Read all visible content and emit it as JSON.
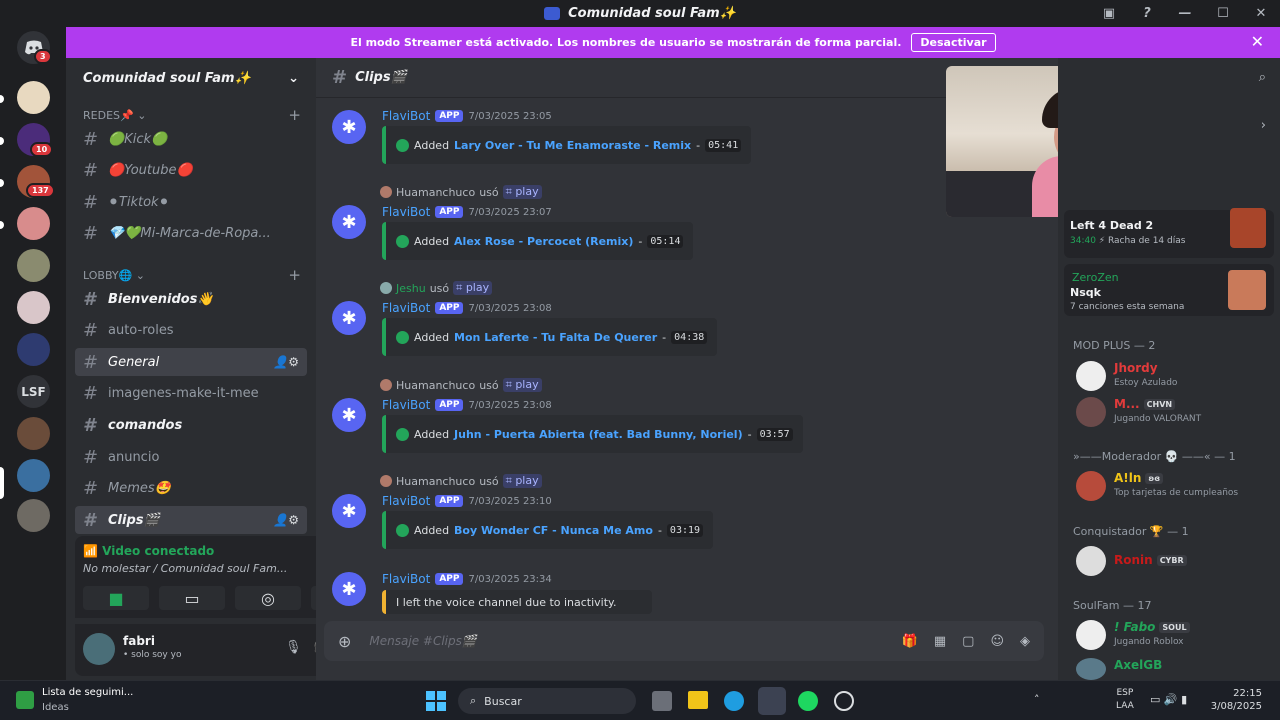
{
  "window": {
    "title": "Comunidad soul Fam✨"
  },
  "banner": {
    "text": "El modo Streamer está activado. Los nombres de usuario se mostrarán de forma parcial.",
    "button": "Desactivar"
  },
  "guilds": {
    "home_badge": "3",
    "badge1": "10",
    "badge2": "137",
    "lsf": "LSF"
  },
  "server": {
    "name": "Comunidad soul Fam✨",
    "cat_redes": "REDES📌",
    "cat_lobby": "LOBBY🌐",
    "channels": [
      {
        "label": "🟢Kick🟢"
      },
      {
        "label": "🔴Youtube🔴"
      },
      {
        "label": "⚫Tiktok⚫"
      },
      {
        "label": "💎💚Mi-Marca-de-Ropa..."
      },
      {
        "label": "Bienvenidos👋"
      },
      {
        "label": "auto-roles"
      },
      {
        "label": "General"
      },
      {
        "label": "imagenes-make-it-mee"
      },
      {
        "label": "comandos"
      },
      {
        "label": "anuncio"
      },
      {
        "label": "Memes🤩"
      },
      {
        "label": "Clips🎬"
      }
    ]
  },
  "voice": {
    "status": "Video conectado",
    "detail": "No molestar / Comunidad soul Fam..."
  },
  "user": {
    "name": "fabri",
    "status": "• solo soy yo"
  },
  "channel_header": {
    "title": "Clips🎬"
  },
  "messages": [
    {
      "reply_user": "Huamanchuco",
      "reply_cmd": "play",
      "author": "FlaviBot",
      "app": "APP",
      "time": "7/03/2025 23:05",
      "added": "Added",
      "song": "Lary Over - Tu Me Enamoraste - Remix",
      "duration": "05:41",
      "used": "usó"
    },
    {
      "reply_user": "Huamanchuco",
      "reply_cmd": "play",
      "author": "FlaviBot",
      "app": "APP",
      "time": "7/03/2025 23:07",
      "added": "Added",
      "song": "Alex Rose - Percocet (Remix)",
      "duration": "05:14",
      "used": "usó"
    },
    {
      "reply_user": "Jeshu",
      "reply_cmd": "play",
      "author": "FlaviBot",
      "app": "APP",
      "time": "7/03/2025 23:08",
      "added": "Added",
      "song": "Mon Laferte - Tu Falta De Querer",
      "duration": "04:38",
      "used": "usó"
    },
    {
      "reply_user": "Huamanchuco",
      "reply_cmd": "play",
      "author": "FlaviBot",
      "app": "APP",
      "time": "7/03/2025 23:08",
      "added": "Added",
      "song": "Juhn - Puerta Abierta (feat. Bad Bunny, Noriel)",
      "duration": "03:57",
      "used": "usó"
    },
    {
      "reply_user": "Huamanchuco",
      "reply_cmd": "play",
      "author": "FlaviBot",
      "app": "APP",
      "time": "7/03/2025 23:10",
      "added": "Added",
      "song": "Boy Wonder CF - Nunca Me Amo",
      "duration": "03:19",
      "used": "usó"
    }
  ],
  "last_msg": {
    "author": "FlaviBot",
    "app": "APP",
    "time": "7/03/2025 23:34",
    "text": "I left the voice channel due to inactivity."
  },
  "input": {
    "placeholder": "Mensaje #Clips🎬"
  },
  "members": {
    "activity1": {
      "title": "Left 4 Dead 2",
      "time": "34:40",
      "streak": "Racha de 14 días"
    },
    "activity2": {
      "user": "ZeroZen",
      "title": "Nsqk",
      "detail": "7 canciones esta semana"
    },
    "cat_mod": "MOD PLUS — 2",
    "jhordy": {
      "name": "Jhordy",
      "status": "Estoy Azulado"
    },
    "m": {
      "name": "M...",
      "tag": "CHVN",
      "status": "Jugando VALORANT"
    },
    "cat_moderador": "»——Moderador 💀 ——« — 1",
    "alln": {
      "name": "A!ln",
      "tag": "ʚɞ",
      "status": "Top tarjetas de cumpleaños"
    },
    "cat_conq": "Conquistador 🏆 — 1",
    "ronin": {
      "name": "Ronin",
      "tag": "CYBR"
    },
    "cat_soul": "SoulFam — 17",
    "fabo": {
      "name": "! Fabo",
      "tag": "SOUL",
      "status": "Jugando Roblox"
    },
    "axel": {
      "name": "AxelGB"
    }
  },
  "taskbar": {
    "app_title": "Lista de seguimi...",
    "app_sub": "Ideas",
    "search": "Buscar",
    "lang1": "ESP",
    "lang2": "LAA",
    "time": "22:15",
    "date": "3/08/2025"
  },
  "colors": {
    "accent": "#5865f2",
    "banner": "#b03bef",
    "green": "#23a55a"
  }
}
